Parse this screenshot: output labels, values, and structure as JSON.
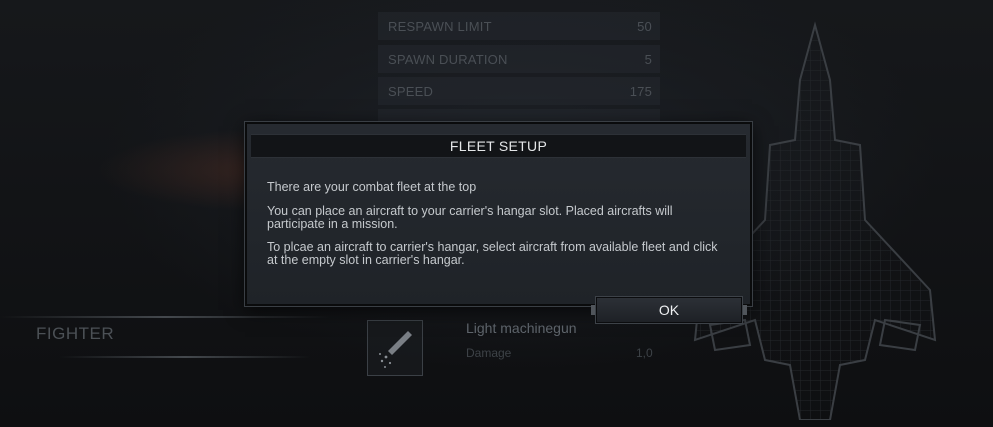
{
  "stats": [
    {
      "label": "RESPAWN LIMIT",
      "value": "50"
    },
    {
      "label": "SPAWN DURATION",
      "value": "5"
    },
    {
      "label": "SPEED",
      "value": "175"
    }
  ],
  "unit": {
    "name": "FIGHTER"
  },
  "weapon": {
    "name": "Light machinegun",
    "damage_label": "Damage",
    "damage_value": "1,0",
    "icon": "bullet-icon"
  },
  "dialog": {
    "title": "FLEET SETUP",
    "paragraphs": [
      "There are your combat fleet at the top",
      "You can place an aircraft to your carrier's hangar slot. Placed aircrafts will participate in a mission.",
      "To plcae an aircraft to carrier's hangar, select aircraft from available fleet and click at the empty slot in carrier's hangar."
    ],
    "ok_label": "OK"
  },
  "colors": {
    "background": "#111214",
    "panel": "#22262b",
    "text": "#c5c9cd"
  }
}
